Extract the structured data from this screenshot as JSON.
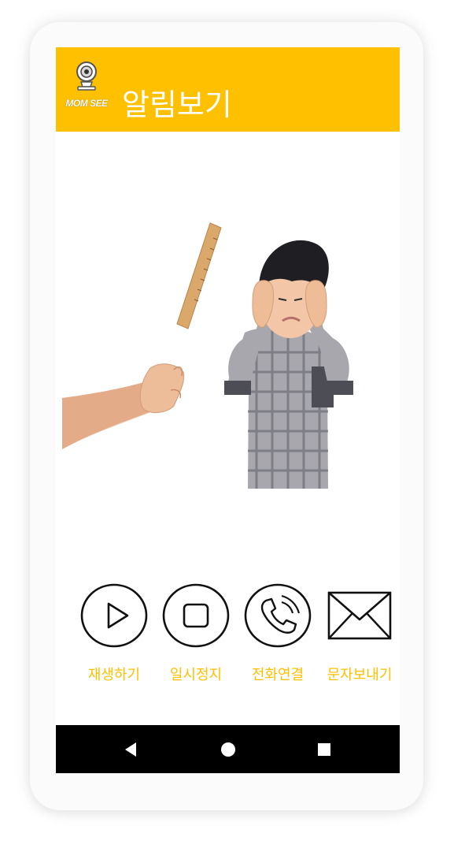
{
  "app": {
    "logo_text": "MOM SEE",
    "title": "알림보기"
  },
  "scene": {
    "description_icon": "alert-photo-child-covering-ears"
  },
  "controls": [
    {
      "icon": "play-icon",
      "label": "재생하기"
    },
    {
      "icon": "stop-icon",
      "label": "일시정지"
    },
    {
      "icon": "phone-icon",
      "label": "전화연결"
    },
    {
      "icon": "envelope-icon",
      "label": "문자보내기"
    }
  ],
  "navigation": {
    "back_icon": "back-triangle-icon",
    "home_icon": "home-circle-icon",
    "recents_icon": "recents-square-icon"
  },
  "colors": {
    "accent": "#ffc000",
    "nav_bar": "#000000",
    "text_on_accent": "#ffffff"
  }
}
